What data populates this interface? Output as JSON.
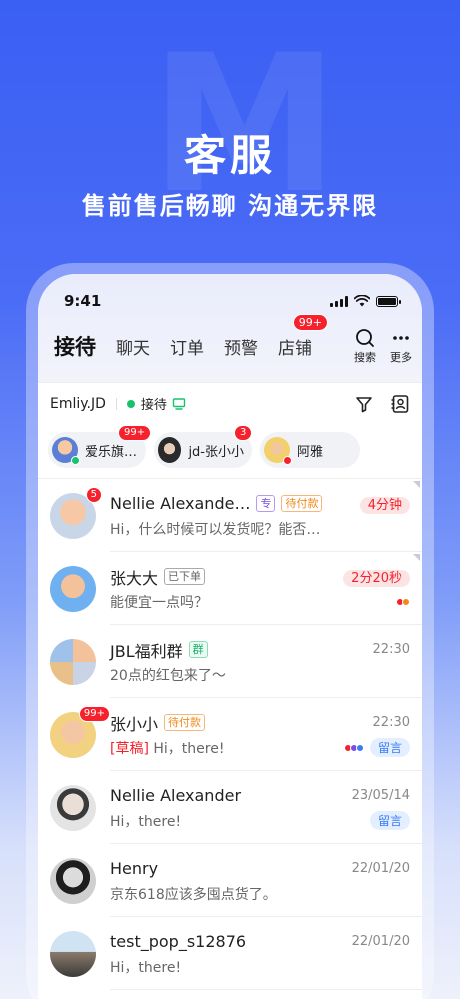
{
  "hero": {
    "title": "客服",
    "subtitle": "售前售后畅聊 沟通无界限"
  },
  "status_bar": {
    "time": "9:41"
  },
  "nav": {
    "tabs": [
      {
        "label": "接待",
        "active": true
      },
      {
        "label": "聊天"
      },
      {
        "label": "订单"
      },
      {
        "label": "预警"
      },
      {
        "label": "店铺",
        "badge": "99+"
      }
    ],
    "actions": [
      {
        "icon": "search-icon",
        "label": "搜索"
      },
      {
        "icon": "more-icon",
        "label": "更多"
      }
    ]
  },
  "subbar": {
    "agent": "Emliy.JD",
    "status": "接待",
    "status_color": "#17c26b"
  },
  "chips": [
    {
      "label": "爱乐旗…",
      "badge": "99+",
      "dot_color": "#17c26b"
    },
    {
      "label": "jd-张小小",
      "badge": "3"
    },
    {
      "label": "阿雅",
      "dot_color": "#f5222d"
    }
  ],
  "conversations": [
    {
      "name": "Nellie Alexande…",
      "tags": [
        {
          "text": "专",
          "style": "purple"
        },
        {
          "text": "待付款",
          "style": "orange"
        }
      ],
      "time": "4分钟",
      "time_style": "pill-red",
      "message": "Hi，什么时候可以发货呢？能否…",
      "badge": "5",
      "corner": true
    },
    {
      "name": "张大大",
      "tags": [
        {
          "text": "已下单",
          "style": "gray"
        }
      ],
      "time": "2分20秒",
      "time_style": "pill-red",
      "message": "能便宜一点吗？",
      "corner": true,
      "dots": [
        "#f5222d",
        "#f08a1c"
      ]
    },
    {
      "name": "JBL福利群",
      "tags": [
        {
          "text": "群",
          "style": "green"
        }
      ],
      "time": "22:30",
      "message": "20点的红包来了～"
    },
    {
      "name": "张小小",
      "tags": [
        {
          "text": "待付款",
          "style": "orange"
        }
      ],
      "time": "22:30",
      "draft": "[草稿]",
      "message": "Hi，there!",
      "badge": "99+",
      "dots": [
        "#f5222d",
        "#7a4de8",
        "#3a7bf5"
      ],
      "pill": "留言"
    },
    {
      "name": "Nellie Alexander",
      "time": "23/05/14",
      "message": "Hi，there!",
      "pill": "留言"
    },
    {
      "name": "Henry",
      "time": "22/01/20",
      "message": "京东618应该多囤点货了。"
    },
    {
      "name": "test_pop_s12876",
      "time": "22/01/20",
      "message": "Hi，there!"
    }
  ]
}
